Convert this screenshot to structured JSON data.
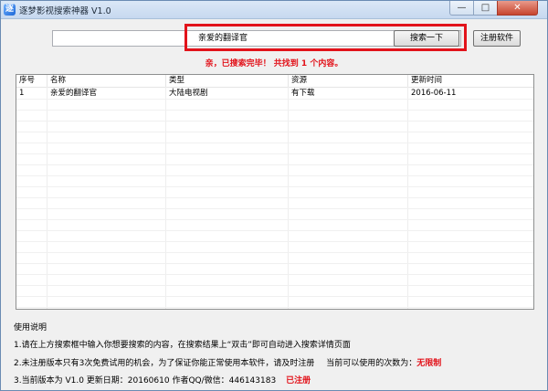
{
  "window": {
    "title": "逐梦影视搜索神器 V1.0",
    "minimize": "—",
    "maximize": "□",
    "close": "✕"
  },
  "search": {
    "value": "亲爱的翻译官",
    "button": "搜索一下",
    "register_button": "注册软件"
  },
  "status": "亲，已搜索完毕！ 共找到 1 个内容。",
  "table": {
    "headers": [
      "序号",
      "名称",
      "类型",
      "资源",
      "更新时间"
    ],
    "rows": [
      [
        "1",
        "亲爱的翻译官",
        "大陆电视剧",
        "有下载",
        "2016-06-11"
      ]
    ]
  },
  "instructions": {
    "heading": "使用说明",
    "line1": "1.请在上方搜索框中输入你想要搜索的内容，在搜索结果上“双击”即可自动进入搜索详情页面",
    "line2_text": "2.未注册版本只有3次免费试用的机会，为了保证你能正常使用本软件，请及时注册",
    "line2_label": "当前可以使用的次数为：",
    "line2_value": "无限制",
    "line3_text": "3.当前版本为 V1.0 更新日期：20160610 作者QQ/微信：446143183",
    "line3_value": "已注册"
  },
  "colors": {
    "accent_red": "#e2131b",
    "title_bar": "#c6d8ef"
  }
}
